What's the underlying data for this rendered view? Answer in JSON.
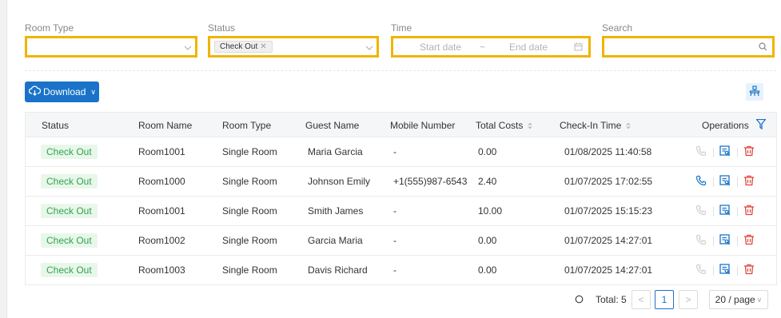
{
  "filters": {
    "room_type": {
      "label": "Room Type",
      "value": ""
    },
    "status": {
      "label": "Status",
      "tag": "Check Out"
    },
    "time": {
      "label": "Time",
      "start_placeholder": "Start date",
      "separator": "~",
      "end_placeholder": "End date"
    },
    "search": {
      "label": "Search",
      "value": ""
    }
  },
  "toolbar": {
    "download_label": "Download"
  },
  "table": {
    "headers": {
      "status": "Status",
      "room_name": "Room Name",
      "room_type": "Room Type",
      "guest_name": "Guest Name",
      "mobile": "Mobile Number",
      "total_costs": "Total Costs",
      "checkin": "Check-In Time",
      "operations": "Operations"
    },
    "rows": [
      {
        "status": "Check Out",
        "room_name": "Room1001",
        "room_type": "Single Room",
        "guest_name": "Maria Garcia",
        "mobile": "-",
        "total_costs": "0.00",
        "checkin": "01/08/2025 11:40:58",
        "call_active": false
      },
      {
        "status": "Check Out",
        "room_name": "Room1000",
        "room_type": "Single Room",
        "guest_name": "Johnson Emily",
        "mobile": "+1(555)987-6543",
        "total_costs": "2.40",
        "checkin": "01/07/2025 17:02:55",
        "call_active": true
      },
      {
        "status": "Check Out",
        "room_name": "Room1001",
        "room_type": "Single Room",
        "guest_name": "Smith James",
        "mobile": "-",
        "total_costs": "10.00",
        "checkin": "01/07/2025 15:15:23",
        "call_active": false
      },
      {
        "status": "Check Out",
        "room_name": "Room1002",
        "room_type": "Single Room",
        "guest_name": "Garcia Maria",
        "mobile": "-",
        "total_costs": "0.00",
        "checkin": "01/07/2025 14:27:01",
        "call_active": false
      },
      {
        "status": "Check Out",
        "room_name": "Room1003",
        "room_type": "Single Room",
        "guest_name": "Davis Richard",
        "mobile": "-",
        "total_costs": "0.00",
        "checkin": "01/07/2025 14:27:01",
        "call_active": false
      }
    ]
  },
  "pagination": {
    "total_label": "Total: 5",
    "current_page": "1",
    "page_size": "20 / page"
  },
  "colors": {
    "accent": "#1a73c8",
    "highlight": "#f0b400",
    "status_green": "#2fa44f",
    "delete_red": "#e0433a"
  },
  "icons": [
    "chevron-down-icon",
    "calendar-icon",
    "search-icon",
    "cloud-download-icon",
    "column-settings-icon",
    "filter-icon",
    "sort-icon",
    "phone-icon",
    "details-icon",
    "delete-icon",
    "refresh-icon",
    "chevron-left-icon",
    "chevron-right-icon"
  ]
}
